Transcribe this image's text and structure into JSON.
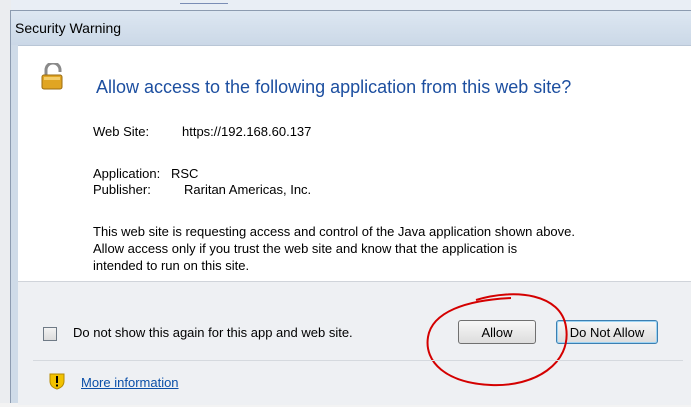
{
  "dialog": {
    "title": "Security Warning",
    "headline": "Allow access to the following application from this web site?",
    "website_label": "Web Site:",
    "website_value": "https://192.168.60.137",
    "application_label": "Application:",
    "application_value": "RSC",
    "publisher_label": "Publisher:",
    "publisher_value": "Raritan Americas, Inc.",
    "description_lines": [
      "This web site is requesting access and control of the Java application shown above.",
      "Allow access only if you trust the web site and know that the application is",
      "intended to run on this site."
    ]
  },
  "footer": {
    "checkbox_label": "Do not show this again for this app and web site.",
    "allow_label": "Allow",
    "deny_label": "Do Not Allow",
    "more_info_label": "More information"
  },
  "colors": {
    "headline": "#1d4fa0",
    "link": "#0b4fa8",
    "annotation_circle": "#d40000",
    "warning_icon": "#f2c200"
  },
  "icons": [
    "lock-shield-icon",
    "warning-info-icon"
  ]
}
